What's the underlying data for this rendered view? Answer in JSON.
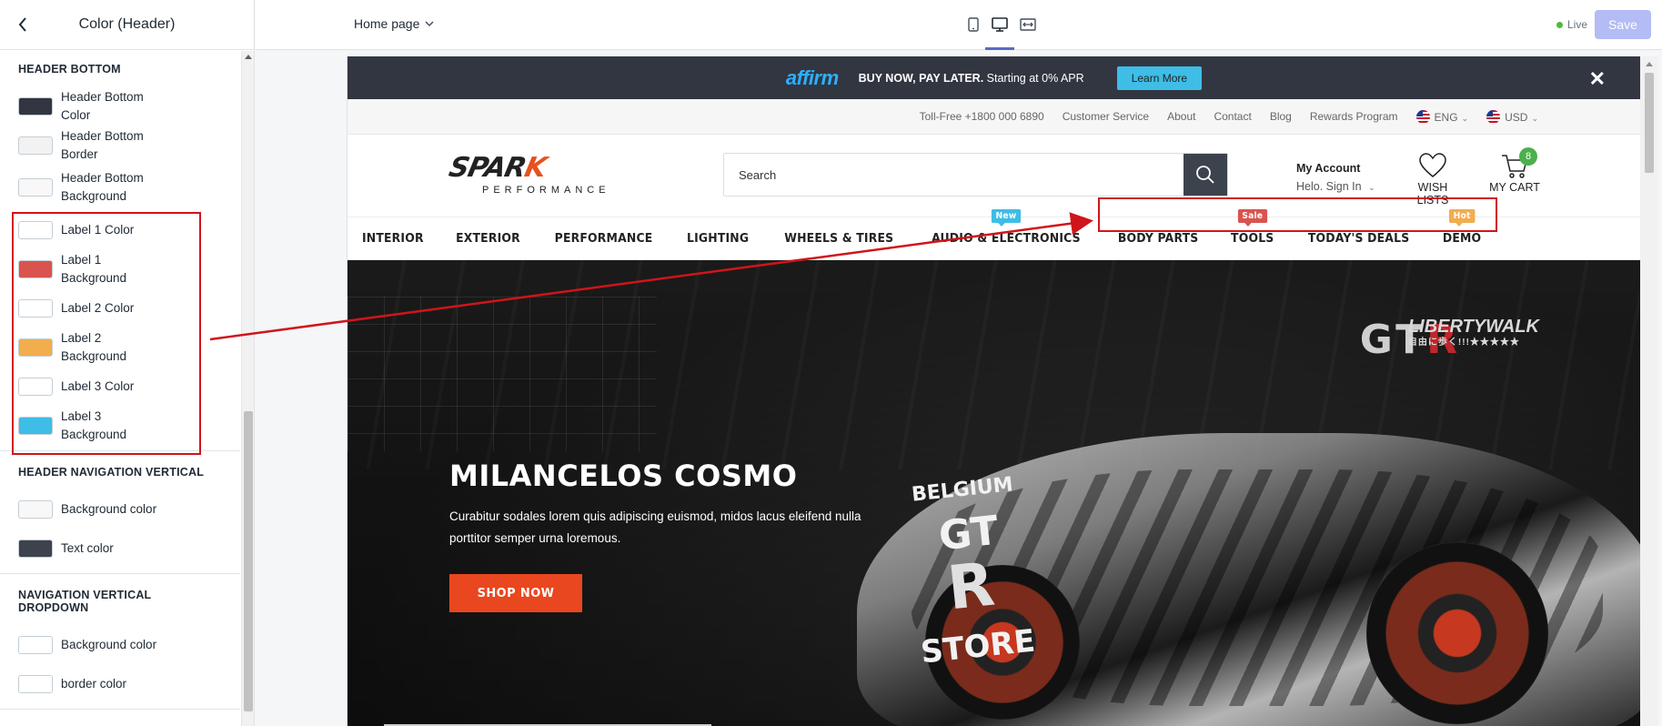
{
  "sidebar": {
    "title": "Color (Header)",
    "sections": [
      {
        "title": "HEADER BOTTOM",
        "items": [
          {
            "label": "Header Bottom Color",
            "color": "#323641"
          },
          {
            "label": "Header Bottom Border",
            "color": "#f2f2f2"
          },
          {
            "label": "Header Bottom Background",
            "color": "#f8f8f8"
          },
          {
            "label": "Label 1 Color",
            "color": "#ffffff"
          },
          {
            "label": "Label 1 Background",
            "color": "#d9534f"
          },
          {
            "label": "Label 2 Color",
            "color": "#ffffff"
          },
          {
            "label": "Label 2 Background",
            "color": "#f2ad4e"
          },
          {
            "label": "Label 3 Color",
            "color": "#ffffff"
          },
          {
            "label": "Label 3 Background",
            "color": "#3ebde6"
          }
        ]
      },
      {
        "title": "HEADER NAVIGATION VERTICAL",
        "items": [
          {
            "label": "Background color",
            "color": "#f8f8f8"
          },
          {
            "label": "Text color",
            "color": "#3c434d"
          }
        ]
      },
      {
        "title": "NAVIGATION VERTICAL DROPDOWN",
        "items": [
          {
            "label": "Background color",
            "color": "#ffffff"
          },
          {
            "label": "border color",
            "color": "#ffffff"
          }
        ]
      }
    ]
  },
  "toolbar": {
    "page": "Home page",
    "status": "Live",
    "save_label": "Save"
  },
  "store": {
    "promo": {
      "brand": "affirm",
      "text_bold": "BUY NOW, PAY LATER.",
      "text_rest": "Starting at 0% APR",
      "button": "Learn More",
      "close": "✕"
    },
    "topnav": {
      "phone": "Toll-Free +1800 000 6890",
      "links": [
        "Customer Service",
        "About",
        "Contact",
        "Blog",
        "Rewards Program"
      ],
      "language": "ENG",
      "currency": "USD"
    },
    "logo": {
      "main_a": "SPAR",
      "main_k": "K",
      "sub": "PERFORMANCE"
    },
    "search_placeholder": "Search",
    "account": {
      "title": "My Account",
      "subtitle": "Helo. Sign In"
    },
    "wishlist_label": "WISH LISTS",
    "cart": {
      "label": "MY CART",
      "count": "8"
    },
    "menu": [
      {
        "label": "INTERIOR"
      },
      {
        "label": "EXTERIOR"
      },
      {
        "label": "PERFORMANCE"
      },
      {
        "label": "LIGHTING"
      },
      {
        "label": "WHEELS & TIRES"
      },
      {
        "label": "AUDIO & ELECTRONICS",
        "badge": "New",
        "badge_class": "lbl-new"
      },
      {
        "label": "BODY PARTS"
      },
      {
        "label": "TOOLS",
        "badge": "Sale",
        "badge_class": "lbl-sale"
      },
      {
        "label": "TODAY'S DEALS"
      },
      {
        "label": "DEMO",
        "badge": "Hot",
        "badge_class": "lbl-hot"
      }
    ],
    "hero": {
      "title": "MILANCELOS COSMO",
      "description": "Curabitur sodales lorem quis adipiscing euismod, midos lacus eleifend nulla porttitor semper urna loremous.",
      "button": "SHOP NOW",
      "car_text_1": "BELGIUM",
      "car_text_2": "GT",
      "car_text_3": "R",
      "car_text_4": "STORE",
      "logo_gt": "GT",
      "logo_r": "R",
      "brand_lw": "LIBERTYWALK",
      "brand_lw_sub": "自由に歩く!!!★★★★★"
    }
  },
  "colors": {
    "annotation": "#d0141b",
    "accent": "#5c6ac4",
    "save_disabled": "#b3bcf5"
  }
}
